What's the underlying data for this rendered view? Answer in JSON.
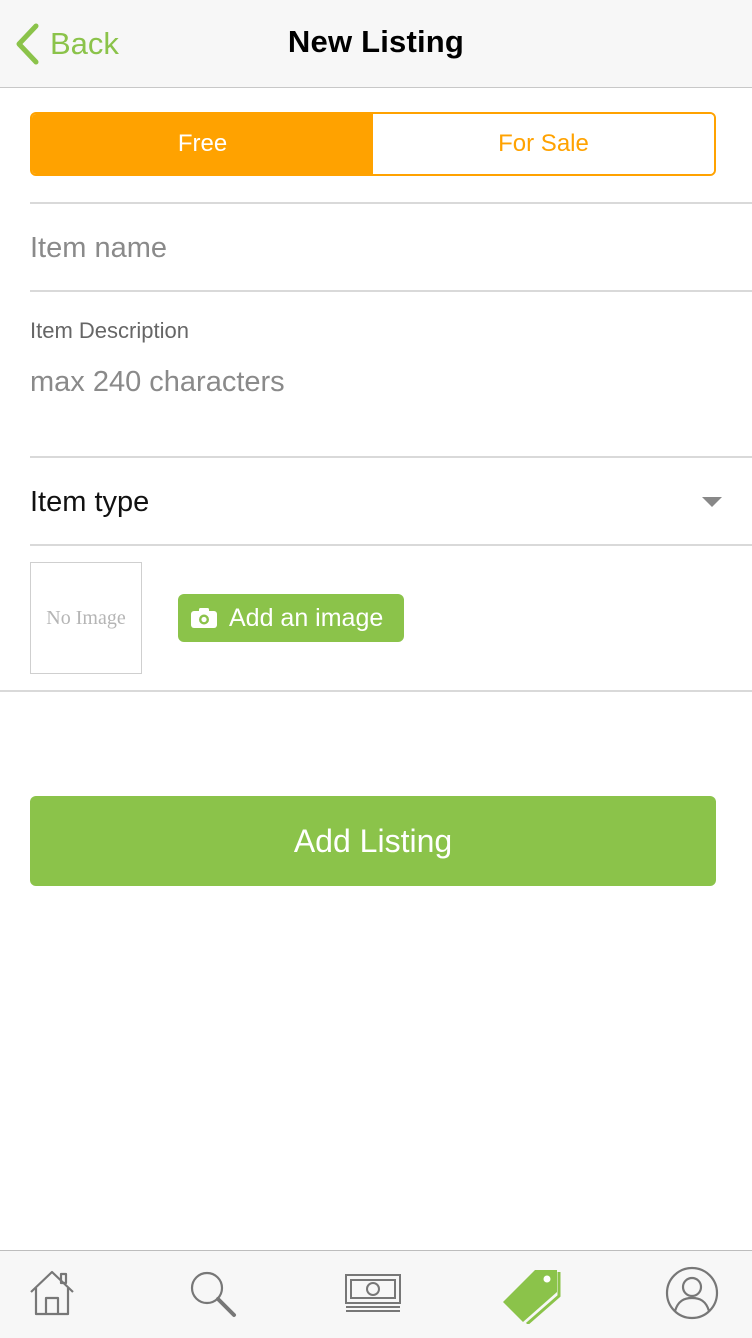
{
  "header": {
    "back_label": "Back",
    "title": "New Listing"
  },
  "listing_mode": {
    "options": [
      "Free",
      "For Sale"
    ],
    "selected": "Free"
  },
  "form": {
    "item_name_placeholder": "Item name",
    "description_label": "Item Description",
    "description_placeholder": "max 240 characters",
    "item_type_label": "Item type",
    "no_image_text": "No Image",
    "add_image_label": "Add an image",
    "submit_label": "Add Listing"
  },
  "tabbar": {
    "items": [
      {
        "icon": "home-icon",
        "active": false
      },
      {
        "icon": "search-icon",
        "active": false
      },
      {
        "icon": "money-icon",
        "active": false
      },
      {
        "icon": "tag-icon",
        "active": true
      },
      {
        "icon": "profile-icon",
        "active": false
      }
    ]
  },
  "colors": {
    "accent_green": "#8bc34a",
    "accent_orange": "#ffa200",
    "inactive_icon": "#777777"
  }
}
